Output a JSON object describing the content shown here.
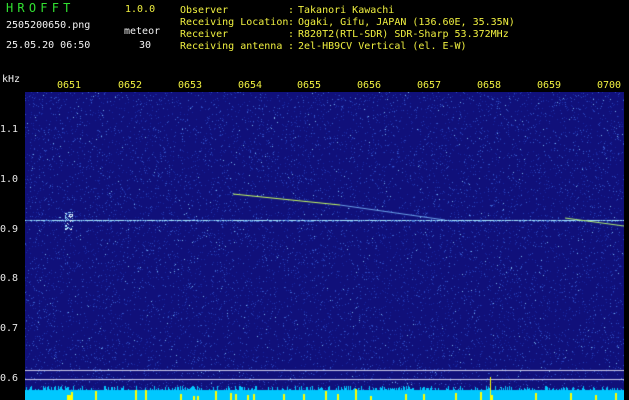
{
  "app": {
    "title": "HROFFT",
    "version": "1.0.0"
  },
  "image_info": {
    "filename": "2505200650.png",
    "datetime": "25.05.20 06:50",
    "meteor_label": "meteor",
    "meteor_count": "30"
  },
  "station": [
    {
      "key": "Observer",
      "value": "Takanori Kawachi"
    },
    {
      "key": "Receiving Location",
      "value": "Ogaki, Gifu, JAPAN (136.60E, 35.35N)"
    },
    {
      "key": "Receiver",
      "value": "R820T2(RTL-SDR) SDR-Sharp 53.372MHz"
    },
    {
      "key": "Receiving antenna",
      "value": "2el-HB9CV Vertical (el. E-W)"
    }
  ],
  "separator": ":",
  "axis": {
    "unit": "kHz",
    "time_ticks": [
      "0651",
      "0652",
      "0653",
      "0654",
      "0655",
      "0656",
      "0657",
      "0658",
      "0659",
      "0700"
    ],
    "freq_ticks": [
      "1.1",
      "1.0",
      "0.9",
      "0.8",
      "0.7",
      "0.6"
    ]
  },
  "colors": {
    "background": "#000000",
    "waterfall_base": "#10107a",
    "noise_bright": "#3c64d0",
    "carrier": "#a8e8ff",
    "meteor_trace": "#c8ff60",
    "bottom_bar": "#00c8ff",
    "bottom_spikes": "#ffff00",
    "label_green": "#31e031",
    "label_yellow": "#f0f040"
  }
}
